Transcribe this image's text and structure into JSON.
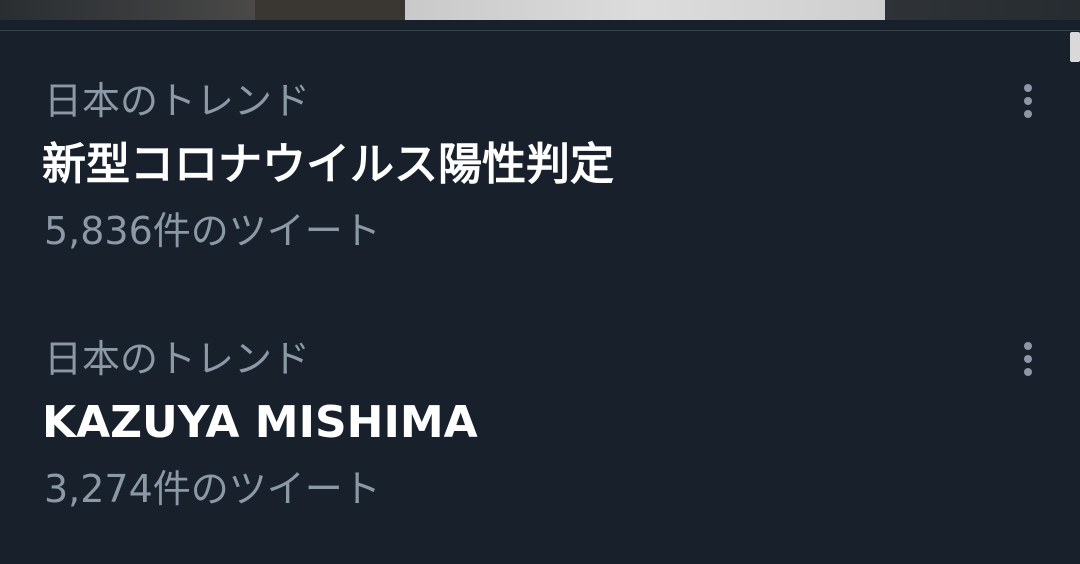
{
  "trends": [
    {
      "context": "日本のトレンド",
      "title": "新型コロナウイルス陽性判定",
      "count": "5,836件のツイート"
    },
    {
      "context": "日本のトレンド",
      "title": "KAZUYA MISHIMA",
      "count": "3,274件のツイート"
    }
  ],
  "icons": {
    "more": "more-vertical-icon"
  },
  "colors": {
    "background": "#17202b",
    "primary_text": "#ffffff",
    "secondary_text": "#8b98a5",
    "divider": "#38444d"
  }
}
